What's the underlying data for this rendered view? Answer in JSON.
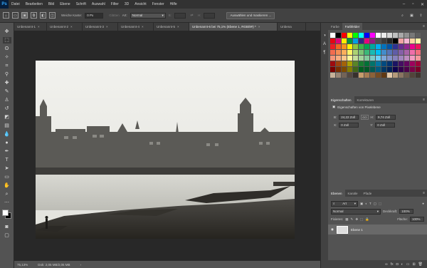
{
  "menubar": {
    "logo": "Ps",
    "items": [
      "Datei",
      "Bearbeiten",
      "Bild",
      "Ebene",
      "Schrift",
      "Auswahl",
      "Filter",
      "3D",
      "Ansicht",
      "Fenster",
      "Hilfe"
    ]
  },
  "options": {
    "feather_label": "Weiche Kante:",
    "feather_value": "0 Px",
    "smooth_label": "Glätten",
    "style_label": "Art:",
    "style_value": "Normal",
    "select_mask_button": "Auswählen und maskieren ..."
  },
  "tabs": [
    {
      "label": "Unbenannt-1",
      "active": false
    },
    {
      "label": "Unbenannt-2",
      "active": false
    },
    {
      "label": "Unbenannt-3",
      "active": false
    },
    {
      "label": "Unbenannt-4",
      "active": false
    },
    {
      "label": "Unbenannt-5",
      "active": false
    },
    {
      "label": "Unbenannt-6 bei 75,1% (Ebene 1, RGB/8#) *",
      "active": true
    },
    {
      "label": "Unbena",
      "active": false
    }
  ],
  "status": {
    "zoom": "75,13%",
    "doc": "Dok: 2,05 MB/2,05 MB"
  },
  "color_panel": {
    "tabs": [
      "Farbe",
      "Farbfelder"
    ],
    "active_tab": "Farbfelder"
  },
  "properties_panel": {
    "tabs": [
      "Eigenschaften",
      "Korrekturen"
    ],
    "subtitle": "Eigenschaften von Pixelebene",
    "w_label": "B:",
    "w_value": "24,22 Zoll",
    "link_label": "GO",
    "h_label": "H:",
    "h_value": "9,74 Zoll",
    "x_label": "X:",
    "x_value": "0 Zoll",
    "y_label": "Y:",
    "y_value": "0 Zoll"
  },
  "layers_panel": {
    "tabs": [
      "Ebenen",
      "Kanäle",
      "Pfade"
    ],
    "filter_value": "Art",
    "blend_mode": "Normal",
    "opacity_label": "Deckkraft:",
    "opacity_value": "100%",
    "lock_label": "Fixieren:",
    "fill_label": "Fläche:",
    "fill_value": "100%",
    "layer_name": "Ebene 1"
  },
  "swatch_rows": [
    [
      "#ffffff",
      "#000000",
      "#ff0000",
      "#ffff00",
      "#00ff00",
      "#00ffff",
      "#0000ff",
      "#ff00ff",
      "#ffffff",
      "#ebebeb",
      "#d6d6d6",
      "#c0c0c0",
      "#a9a9a9",
      "#919191",
      "#787878",
      "#5e5e5e"
    ],
    [
      "#e30613",
      "#e2007a",
      "#ffed00",
      "#009640",
      "#009fe3",
      "#312783",
      "#e6007e",
      "#951b81",
      "#4d4d4d",
      "#3b3b3b",
      "#262626",
      "#000000",
      "#f2a4a4",
      "#f5b7d3",
      "#fbd4a4",
      "#fff5a8"
    ],
    [
      "#ed1c24",
      "#f26522",
      "#f7941d",
      "#fff200",
      "#8dc63f",
      "#39b54a",
      "#00a651",
      "#00a99d",
      "#00aeef",
      "#0072bc",
      "#0054a6",
      "#2e3192",
      "#662d91",
      "#92278f",
      "#ec008c",
      "#ed145b"
    ],
    [
      "#f26c4f",
      "#f68e55",
      "#fbaf5c",
      "#fff467",
      "#acd372",
      "#7cc576",
      "#3bb878",
      "#1abbb4",
      "#00bff3",
      "#438ccb",
      "#5574b9",
      "#605ca8",
      "#8560a8",
      "#a763a8",
      "#f06eaa",
      "#f26d7d"
    ],
    [
      "#f69679",
      "#f9ad81",
      "#fdc68a",
      "#fff799",
      "#c4df9b",
      "#a3d39c",
      "#82ca9c",
      "#7accc8",
      "#6dcff6",
      "#7da7d9",
      "#8393ca",
      "#8781bd",
      "#a186be",
      "#bd8cbf",
      "#f49ac1",
      "#f5989d"
    ],
    [
      "#9e0b0f",
      "#a0410d",
      "#a3620a",
      "#aba000",
      "#598527",
      "#197b30",
      "#007236",
      "#00746b",
      "#0076a3",
      "#004a80",
      "#003471",
      "#1b1464",
      "#440e62",
      "#630460",
      "#9e005d",
      "#9e0039"
    ],
    [
      "#790000",
      "#7b2e00",
      "#7d4900",
      "#827b00",
      "#406618",
      "#005e20",
      "#005826",
      "#005952",
      "#005b7f",
      "#003663",
      "#002157",
      "#0d004c",
      "#32004b",
      "#4b0049",
      "#7b0046",
      "#7a0026"
    ],
    [
      "#c7b299",
      "#998675",
      "#736357",
      "#534741",
      "#37302d",
      "#c69c6d",
      "#a67c52",
      "#8c6239",
      "#754c24",
      "#603913",
      "#e3c8a8",
      "#b59a7a",
      "#8a7561",
      "#6b5a4c",
      "#52443a",
      "#3f342d"
    ]
  ],
  "tools": [
    "move-tool",
    "marquee-tool",
    "lasso-tool",
    "magic-wand-tool",
    "crop-tool",
    "eyedropper-tool",
    "healing-brush-tool",
    "brush-tool",
    "clone-stamp-tool",
    "history-brush-tool",
    "eraser-tool",
    "gradient-tool",
    "blur-tool",
    "dodge-tool",
    "pen-tool",
    "type-tool",
    "path-selection-tool",
    "rectangle-tool",
    "hand-tool",
    "zoom-tool"
  ]
}
